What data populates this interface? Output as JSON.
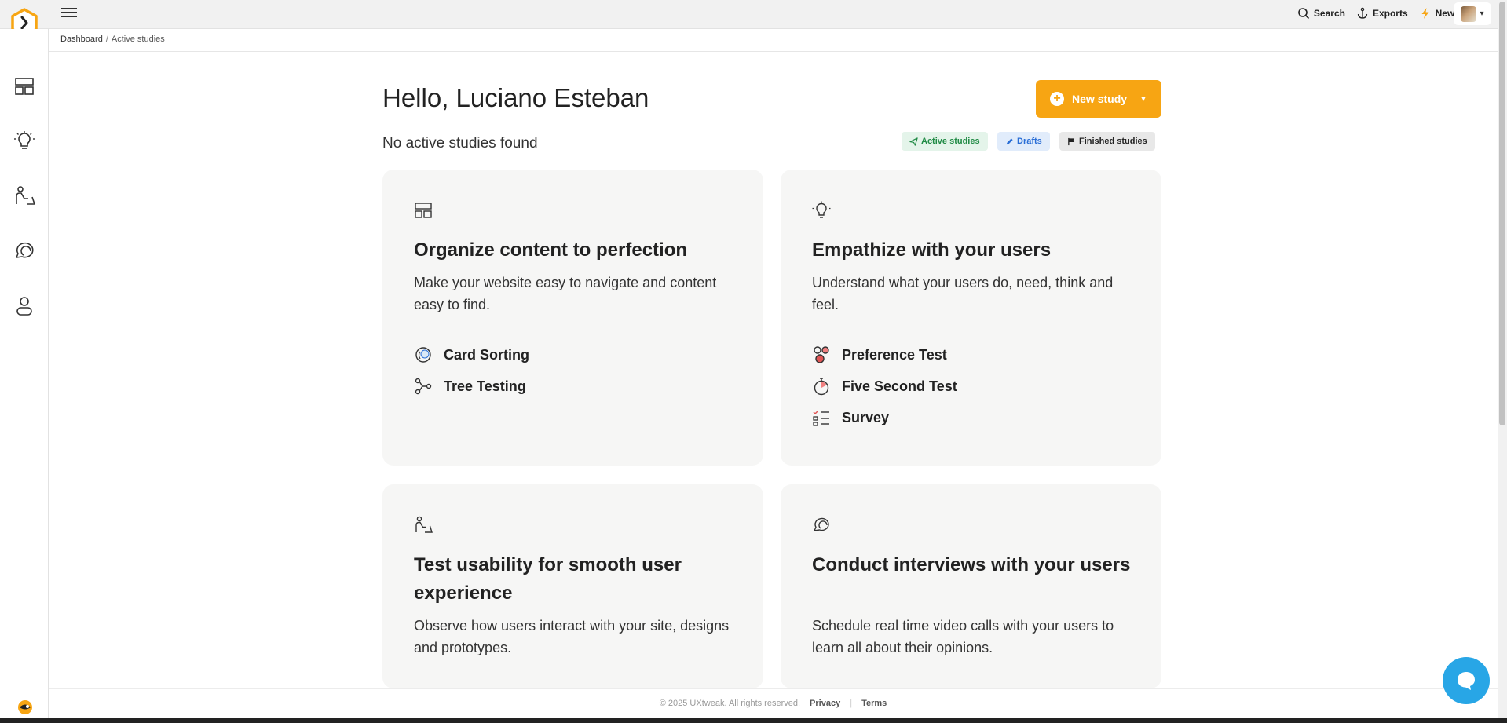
{
  "header": {
    "search_label": "Search",
    "exports_label": "Exports",
    "news_label": "News",
    "brand_color": "#f7a513"
  },
  "breadcrumb": {
    "items": [
      "Dashboard",
      "Active studies"
    ],
    "separator": "/"
  },
  "main": {
    "greeting": "Hello, Luciano Esteban",
    "status": "No active studies found",
    "new_study_label": "New study",
    "filters": {
      "active": "Active studies",
      "drafts": "Drafts",
      "finished": "Finished studies"
    }
  },
  "cards": {
    "organize": {
      "title": "Organize content to perfection",
      "description": "Make your website easy to navigate and content easy to find.",
      "methods": [
        "Card Sorting",
        "Tree Testing"
      ]
    },
    "empathize": {
      "title": "Empathize with your users",
      "description": "Understand what your users do, need, think and feel.",
      "methods": [
        "Preference Test",
        "Five Second Test",
        "Survey"
      ]
    },
    "usability": {
      "title": "Test usability for smooth user experience",
      "description": "Observe how users interact with your site, designs and prototypes."
    },
    "interviews": {
      "title": "Conduct interviews with your users",
      "description": "Schedule real time video calls with your users to learn all about their opinions."
    }
  },
  "footer": {
    "copyright": "© 2025 UXtweak. All rights reserved.",
    "privacy": "Privacy",
    "separator": "|",
    "terms": "Terms"
  }
}
